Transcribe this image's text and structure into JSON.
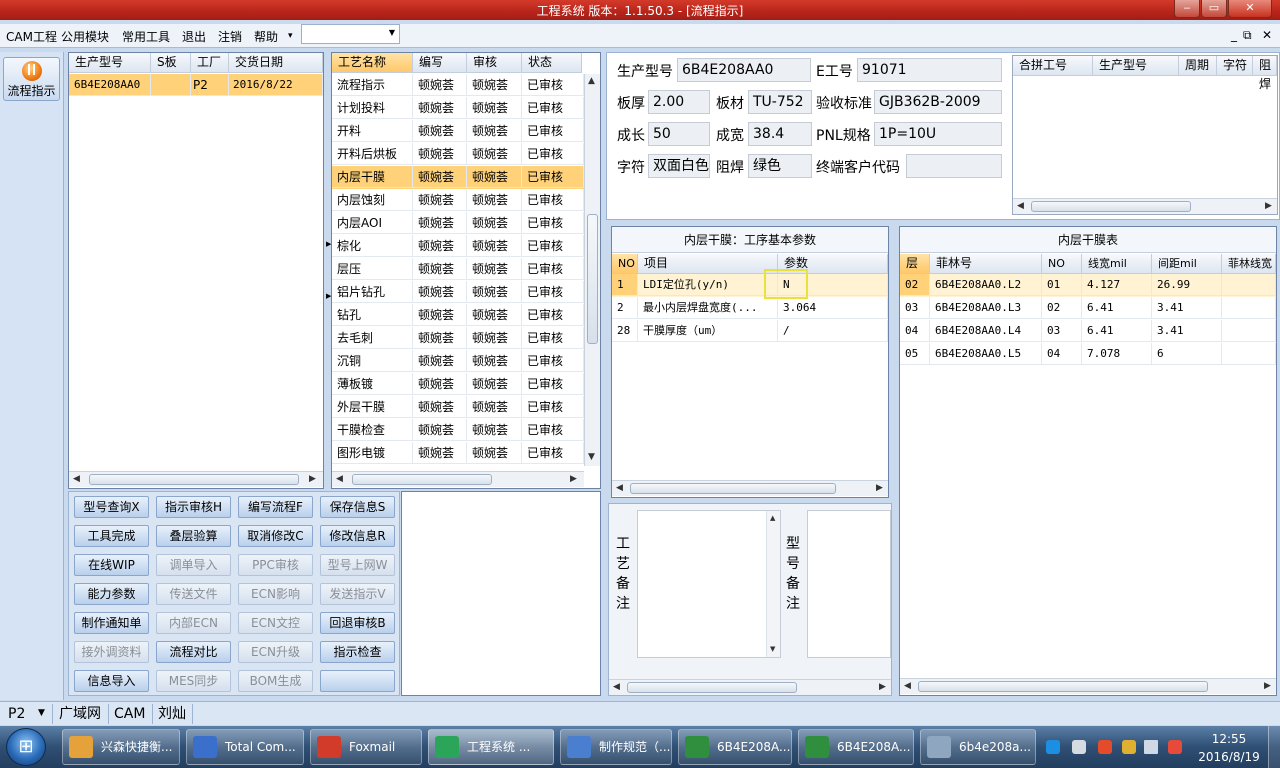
{
  "window": {
    "title": "工程系统  版本：1.1.50.3 - [流程指示]"
  },
  "window_controls": {
    "minimize": "‒",
    "maximize": "▭",
    "close": "✕"
  },
  "mdi_controls": {
    "minimize": "_",
    "restore": "⧉",
    "close": "✕"
  },
  "menu": {
    "items": [
      "CAM工程",
      "公用模块",
      "常用工具",
      "退出",
      "注销",
      "帮助"
    ],
    "help_arrow": "▾",
    "combo_value": ""
  },
  "nav": {
    "button_label": "流程指示"
  },
  "parts": {
    "headers": [
      "生产型号",
      "S板",
      "工厂",
      "交货日期"
    ],
    "rows": [
      [
        "6B4E208AA0",
        "",
        "P2",
        "2016/8/22"
      ]
    ]
  },
  "process": {
    "headers": [
      "工艺名称",
      "编写",
      "审核",
      "状态"
    ],
    "rows": [
      [
        "流程指示",
        "顿婉荟",
        "顿婉荟",
        "已审核"
      ],
      [
        "计划投料",
        "顿婉荟",
        "顿婉荟",
        "已审核"
      ],
      [
        "开料",
        "顿婉荟",
        "顿婉荟",
        "已审核"
      ],
      [
        "开料后烘板",
        "顿婉荟",
        "顿婉荟",
        "已审核"
      ],
      [
        "内层干膜",
        "顿婉荟",
        "顿婉荟",
        "已审核"
      ],
      [
        "内层蚀刻",
        "顿婉荟",
        "顿婉荟",
        "已审核"
      ],
      [
        "内层AOI",
        "顿婉荟",
        "顿婉荟",
        "已审核"
      ],
      [
        "棕化",
        "顿婉荟",
        "顿婉荟",
        "已审核"
      ],
      [
        "层压",
        "顿婉荟",
        "顿婉荟",
        "已审核"
      ],
      [
        "铝片钻孔",
        "顿婉荟",
        "顿婉荟",
        "已审核"
      ],
      [
        "钻孔",
        "顿婉荟",
        "顿婉荟",
        "已审核"
      ],
      [
        "去毛刺",
        "顿婉荟",
        "顿婉荟",
        "已审核"
      ],
      [
        "沉铜",
        "顿婉荟",
        "顿婉荟",
        "已审核"
      ],
      [
        "薄板镀",
        "顿婉荟",
        "顿婉荟",
        "已审核"
      ],
      [
        "外层干膜",
        "顿婉荟",
        "顿婉荟",
        "已审核"
      ],
      [
        "干膜检查",
        "顿婉荟",
        "顿婉荟",
        "已审核"
      ],
      [
        "图形电镀",
        "顿婉荟",
        "顿婉荟",
        "已审核"
      ]
    ]
  },
  "buttons": [
    [
      "型号查询X",
      "指示审核H",
      "编写流程F",
      "保存信息S"
    ],
    [
      "工具完成",
      "叠层验算",
      "取消修改C",
      "修改信息R"
    ],
    [
      "在线WIP",
      "调单导入",
      "PPC审核",
      "型号上网W"
    ],
    [
      "能力参数",
      "传送文件",
      "ECN影响",
      "发送指示V"
    ],
    [
      "制作通知单",
      "内部ECN",
      "ECN文控",
      "回退审核B"
    ],
    [
      "接外调资料",
      "流程对比",
      "ECN升级",
      "指示检查"
    ],
    [
      "信息导入",
      "MES同步",
      "BOM生成",
      ""
    ]
  ],
  "info": {
    "labels": [
      "生产型号",
      "E工号",
      "板厚",
      "板材",
      "验收标准",
      "成长",
      "成宽",
      "PNL规格",
      "字符",
      "阻焊",
      "终端客户代码"
    ],
    "values": {
      "model": "6B4E208AA0",
      "e_no": "91071",
      "thickness": "2.00",
      "material": "TU-752",
      "standard": "GJB362B-2009",
      "length": "50",
      "width": "38.4",
      "pnl": "1P=10U",
      "char": "双面白色",
      "mask": "绿色",
      "client_code": ""
    }
  },
  "merge": {
    "headers": [
      "合拼工号",
      "生产型号",
      "周期",
      "字符",
      "阻焊"
    ]
  },
  "params": {
    "title": "内层干膜：工序基本参数",
    "headers": [
      "NO",
      "项目",
      "参数"
    ],
    "rows": [
      [
        "1",
        "LDI定位孔(y/n)",
        "N"
      ],
      [
        "2",
        "最小内层焊盘宽度(...",
        "3.064"
      ],
      [
        "28",
        "干膜厚度（um）",
        "/"
      ]
    ]
  },
  "films": {
    "title": "内层干膜表",
    "headers": [
      "层",
      "菲林号",
      "NO",
      "线宽mil",
      "间距mil",
      "菲林线宽"
    ],
    "rows": [
      [
        "02",
        "6B4E208AA0.L2",
        "01",
        "4.127",
        "26.99",
        ""
      ],
      [
        "03",
        "6B4E208AA0.L3",
        "02",
        "6.41",
        "3.41",
        ""
      ],
      [
        "04",
        "6B4E208AA0.L4",
        "03",
        "6.41",
        "3.41",
        ""
      ],
      [
        "05",
        "6B4E208AA0.L5",
        "04",
        "7.078",
        "6",
        ""
      ]
    ]
  },
  "notes": {
    "craft_label": "工艺备注",
    "model_label": "型号备注"
  },
  "statusbar": {
    "items": [
      "P2",
      "广域网",
      "CAM",
      "刘灿"
    ]
  },
  "taskbar": {
    "start_label": "⊞",
    "tasks": [
      "兴森快捷衡...",
      "Total Com...",
      "Foxmail",
      "工程系统 ...",
      "制作规范（...",
      "6B4E208A...",
      "6B4E208A...",
      "6b4e208a..."
    ],
    "time": "12:55",
    "date": "2016/8/19"
  }
}
